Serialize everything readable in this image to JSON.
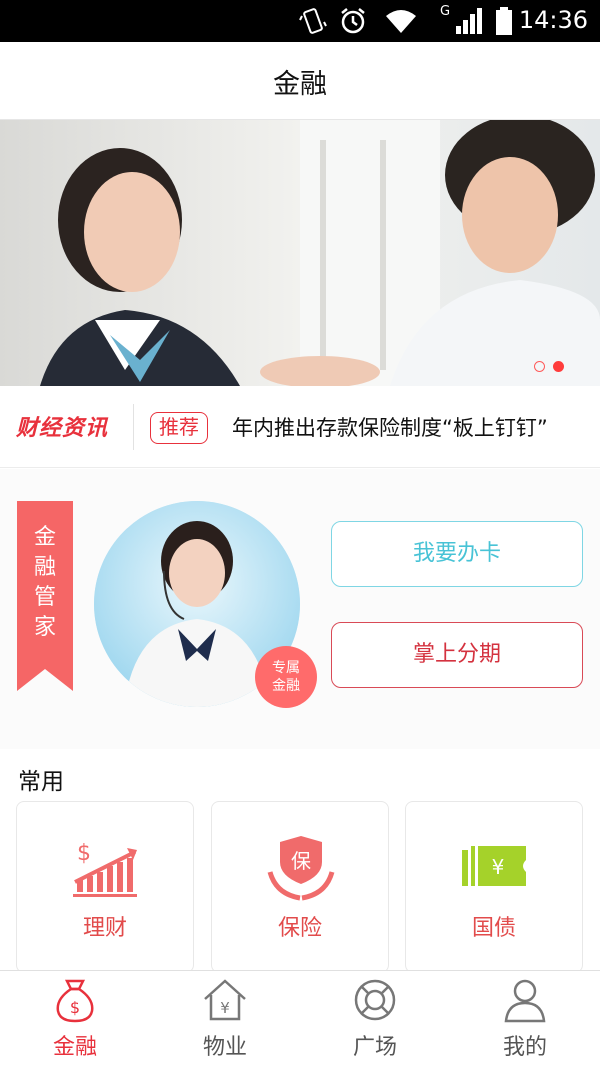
{
  "status_bar": {
    "time": "14:36",
    "network": "G"
  },
  "header": {
    "title": "金融"
  },
  "banner": {
    "slide_count": 2,
    "active_index": 1
  },
  "news": {
    "brand": "财经资讯",
    "tag": "推荐",
    "headline": "年内推出存款保险制度“板上钉钉”"
  },
  "manager": {
    "ribbon_lines": [
      "金",
      "融",
      "管",
      "家"
    ],
    "badge_lines": [
      "专属",
      "金融"
    ],
    "apply_card_label": "我要办卡",
    "installment_label": "掌上分期"
  },
  "common": {
    "label": "常用",
    "tiles": [
      {
        "label": "理财",
        "icon": "wealth-chart-icon"
      },
      {
        "label": "保险",
        "icon": "insurance-shield-icon"
      },
      {
        "label": "国债",
        "icon": "bond-ticket-icon"
      }
    ]
  },
  "bottom_nav": {
    "items": [
      {
        "label": "金融",
        "icon": "money-bag-icon",
        "active": true
      },
      {
        "label": "物业",
        "icon": "house-yen-icon",
        "active": false
      },
      {
        "label": "广场",
        "icon": "lifebuoy-icon",
        "active": false
      },
      {
        "label": "我的",
        "icon": "user-icon",
        "active": false
      }
    ]
  },
  "colors": {
    "accent": "#e8313c",
    "teal": "#48c3d6",
    "ribbon": "#f56666",
    "bond_green": "#a5d22a"
  }
}
